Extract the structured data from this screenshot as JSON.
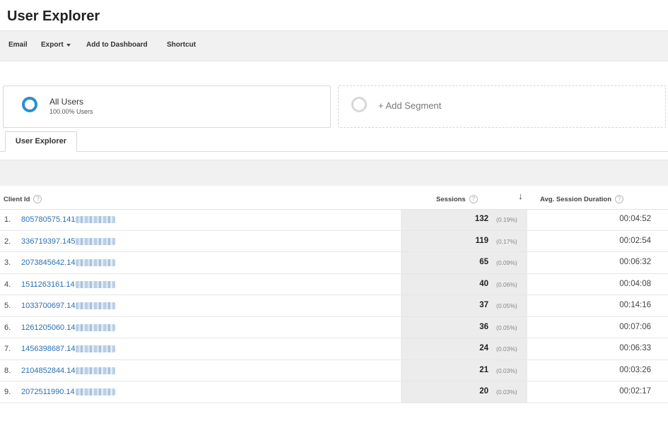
{
  "page_title": "User Explorer",
  "toolbar": {
    "email": "Email",
    "export": "Export",
    "add_to_dashboard": "Add to Dashboard",
    "shortcut": "Shortcut"
  },
  "segments": {
    "all_users_title": "All Users",
    "all_users_sub": "100.00% Users",
    "add_segment": "+ Add Segment"
  },
  "tab": "User Explorer",
  "table": {
    "headers": {
      "client_id": "Client Id",
      "sessions": "Sessions",
      "avg_duration": "Avg. Session Duration"
    },
    "rows": [
      {
        "n": "1.",
        "client": "805780575.141",
        "sessions": "132",
        "pct": "(0.19%)",
        "duration": "00:04:52"
      },
      {
        "n": "2.",
        "client": "336719397.145",
        "sessions": "119",
        "pct": "(0.17%)",
        "duration": "00:02:54"
      },
      {
        "n": "3.",
        "client": "2073845642.14",
        "sessions": "65",
        "pct": "(0.09%)",
        "duration": "00:06:32"
      },
      {
        "n": "4.",
        "client": "1511263161.14",
        "sessions": "40",
        "pct": "(0.06%)",
        "duration": "00:04:08"
      },
      {
        "n": "5.",
        "client": "1033700697.14",
        "sessions": "37",
        "pct": "(0.05%)",
        "duration": "00:14:16"
      },
      {
        "n": "6.",
        "client": "1261205060.14",
        "sessions": "36",
        "pct": "(0.05%)",
        "duration": "00:07:06"
      },
      {
        "n": "7.",
        "client": "1456398687.14",
        "sessions": "24",
        "pct": "(0.03%)",
        "duration": "00:06:33"
      },
      {
        "n": "8.",
        "client": "2104852844.14",
        "sessions": "21",
        "pct": "(0.03%)",
        "duration": "00:03:26"
      },
      {
        "n": "9.",
        "client": "2072511990.14",
        "sessions": "20",
        "pct": "(0.03%)",
        "duration": "00:02:17"
      }
    ]
  },
  "colors": {
    "accent": "#2a8fcf",
    "link": "#2a6fb5"
  }
}
